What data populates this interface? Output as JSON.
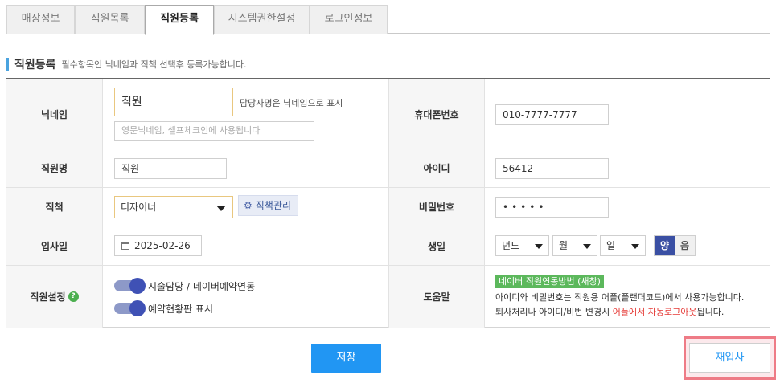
{
  "tabs": [
    {
      "label": "매장정보"
    },
    {
      "label": "직원목록"
    },
    {
      "label": "직원등록",
      "active": true
    },
    {
      "label": "시스템권한설정"
    },
    {
      "label": "로그인정보"
    }
  ],
  "section": {
    "title": "직원등록",
    "note": "필수항목인 닉네임과 직책 선택후 등록가능합니다."
  },
  "form": {
    "nickname": {
      "label": "닉네임",
      "value": "직원",
      "hint": "담당자명은 닉네임으로 표시",
      "english_placeholder": "영문닉네임, 셀프체크인에 사용됩니다"
    },
    "phone": {
      "label": "휴대폰번호",
      "value": "010-7777-7777"
    },
    "name": {
      "label": "직원명",
      "value": "직원"
    },
    "user_id": {
      "label": "아이디",
      "value": "56412"
    },
    "position": {
      "label": "직책",
      "value": "디자이너",
      "manage_button": "직책관리"
    },
    "password": {
      "label": "비밀번호",
      "value": "•••••"
    },
    "hire_date": {
      "label": "입사일",
      "value": "2025-02-26"
    },
    "birthday": {
      "label": "생일",
      "year": "년도",
      "month": "월",
      "day": "일",
      "solar": "양",
      "lunar": "음"
    },
    "staff_settings": {
      "label": "직원설정",
      "help_icon": "?",
      "toggle1": "시술담당 / 네이버예약연동",
      "toggle2": "예약현황판 표시"
    },
    "help": {
      "label": "도움말",
      "badge": "네이버 직원연동방법 (새창)",
      "line1": "아이디와 비밀번호는 직원용 어플(플랜더코드)에서 사용가능합니다.",
      "line2_prefix": "퇴사처리나 아이디/비번 변경시 ",
      "line2_red": "어플에서 자동로그아웃",
      "line2_suffix": "됩니다."
    }
  },
  "buttons": {
    "save": "저장",
    "rehire": "재입사"
  },
  "colors": {
    "primary": "#2196f3",
    "highlight_border": "#e9c77f",
    "toggle_on": "#3f51b5",
    "help_badge": "#5cb85c",
    "warning_text": "#e53935",
    "rehire_frame": "#ee7b86"
  }
}
